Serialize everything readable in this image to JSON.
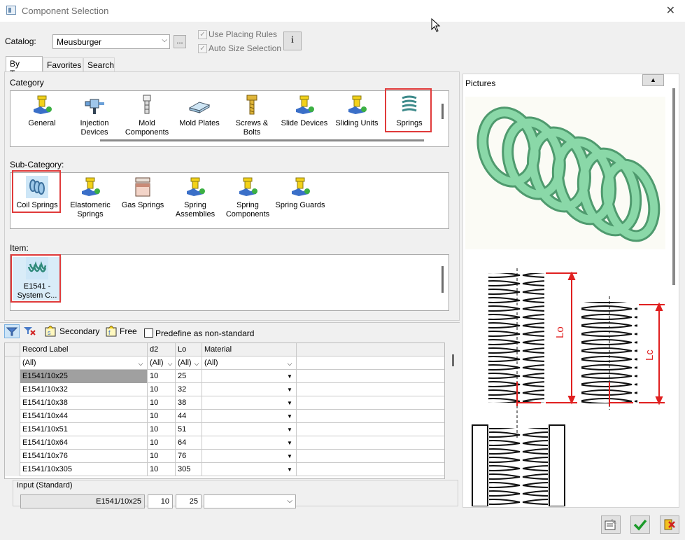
{
  "window": {
    "title": "Component Selection",
    "close": "✕"
  },
  "catalog": {
    "label": "Catalog:",
    "value": "Meusburger",
    "browse": "..."
  },
  "options": {
    "use_placing_rules": "Use Placing Rules",
    "auto_size_selection": "Auto Size Selection",
    "info": "i"
  },
  "tabs": [
    {
      "label": "By Type"
    },
    {
      "label": "Favorites"
    },
    {
      "label": "Search"
    }
  ],
  "category": {
    "label": "Category",
    "items": [
      {
        "label": "General"
      },
      {
        "label": "Injection Devices"
      },
      {
        "label": "Mold Components"
      },
      {
        "label": "Mold Plates"
      },
      {
        "label": "Screws & Bolts"
      },
      {
        "label": "Slide Devices"
      },
      {
        "label": "Sliding Units"
      },
      {
        "label": "Springs"
      }
    ]
  },
  "subcategory": {
    "label": "Sub-Category:",
    "items": [
      {
        "label": "Coil Springs"
      },
      {
        "label": "Elastomeric Springs"
      },
      {
        "label": "Gas Springs"
      },
      {
        "label": "Spring Assemblies"
      },
      {
        "label": "Spring Components"
      },
      {
        "label": "Spring Guards"
      }
    ]
  },
  "item": {
    "label": "Item:",
    "items": [
      {
        "label": "E1541 - System C..."
      }
    ]
  },
  "toolbar": {
    "secondary": "Secondary",
    "free": "Free",
    "predefine": "Predefine as non-standard"
  },
  "table": {
    "columns": [
      "Record Label",
      "d2",
      "Lo",
      "Material"
    ],
    "filters": [
      "(All)",
      "(All)",
      "(All)",
      "(All)"
    ],
    "rows": [
      {
        "label": "E1541/10x25",
        "d2": "10",
        "lo": "25",
        "material": ""
      },
      {
        "label": "E1541/10x32",
        "d2": "10",
        "lo": "32",
        "material": ""
      },
      {
        "label": "E1541/10x38",
        "d2": "10",
        "lo": "38",
        "material": ""
      },
      {
        "label": "E1541/10x44",
        "d2": "10",
        "lo": "44",
        "material": ""
      },
      {
        "label": "E1541/10x51",
        "d2": "10",
        "lo": "51",
        "material": ""
      },
      {
        "label": "E1541/10x64",
        "d2": "10",
        "lo": "64",
        "material": ""
      },
      {
        "label": "E1541/10x76",
        "d2": "10",
        "lo": "76",
        "material": ""
      },
      {
        "label": "E1541/10x305",
        "d2": "10",
        "lo": "305",
        "material": ""
      }
    ]
  },
  "input": {
    "label": "Input (Standard)",
    "record": "E1541/10x25",
    "d2": "10",
    "lo": "25",
    "material": ""
  },
  "pictures": {
    "label": "Pictures",
    "dim_lo": "Lo",
    "dim_lc": "Lc"
  },
  "colors": {
    "accent": "#e03a3a",
    "spring": "#7fd4a0",
    "selected_row": "#a0a0a0"
  }
}
